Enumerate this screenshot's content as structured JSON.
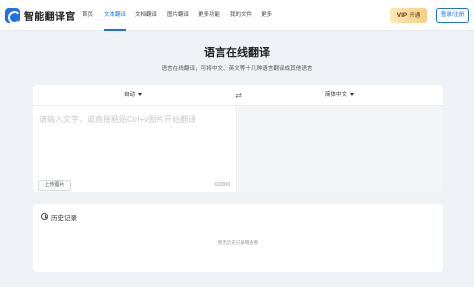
{
  "app": {
    "name": "智能翻译官",
    "colors": {
      "accent": "#1f6fe6",
      "background": "#eef1f5",
      "vip_gold": "#f7cf86"
    }
  },
  "nav": {
    "items": [
      {
        "label": "首页"
      },
      {
        "label": "文本翻译",
        "active": true
      },
      {
        "label": "文档翻译"
      },
      {
        "label": "图片翻译"
      },
      {
        "label": "更多功能"
      },
      {
        "label": "我的文件"
      },
      {
        "label": "更多"
      }
    ],
    "vip_badge": "VIP",
    "vip_label": "开通",
    "login_label": "登录/注册"
  },
  "hero": {
    "title": "语言在线翻译",
    "subtitle": "语言在线翻译，可将中文、英文等十几种语言翻译成其他语言"
  },
  "translator": {
    "source_lang": "自动",
    "target_lang": "简体中文",
    "swap_icon": "swap-icon",
    "input_placeholder": "请输入文字，或直接粘贴Ctrl+v图片开始翻译",
    "upload_label": "上传图片",
    "char_count": "0/2000"
  },
  "history": {
    "title": "历史记录",
    "empty_text": "暂无历史记录哦查看"
  }
}
